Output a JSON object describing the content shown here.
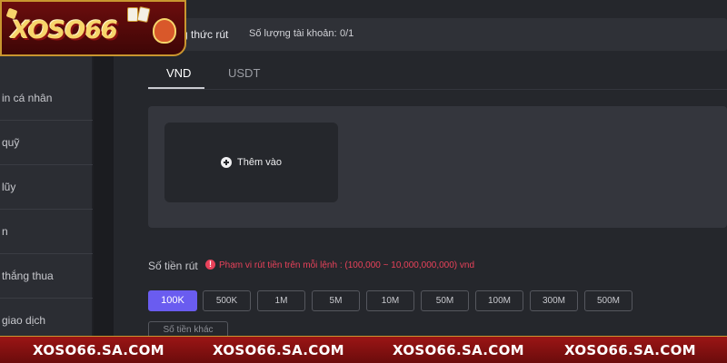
{
  "logo": {
    "text": "XOSO66"
  },
  "header": {
    "title": "g thức rút",
    "account_count_label": "Số lượng tài khoản:",
    "account_count_value": "0/1"
  },
  "sidebar": {
    "items": [
      {
        "label": "in cá nhân"
      },
      {
        "label": "quỹ"
      },
      {
        "label": "lũy"
      },
      {
        "label": "n"
      },
      {
        "label": "thắng thua"
      },
      {
        "label": "giao dịch"
      }
    ]
  },
  "tabs": [
    {
      "label": "VND",
      "active": true
    },
    {
      "label": "USDT",
      "active": false
    }
  ],
  "add_card": {
    "label": "Thêm vào",
    "icon": "plus-circle-icon"
  },
  "amount": {
    "label": "Số tiền rút",
    "range_note": "Phạm vi rút tiền trên mỗi lệnh : (100,000 ~ 10,000,000,000) vnd",
    "options": [
      "100K",
      "500K",
      "1M",
      "5M",
      "10M",
      "50M",
      "100M",
      "300M",
      "500M"
    ],
    "selected": "100K",
    "other_label": "Số tiền khác"
  },
  "banner": {
    "items": [
      "XOSO66.SA.COM",
      "XOSO66.SA.COM",
      "XOSO66.SA.COM",
      "XOSO66.SA.COM"
    ]
  },
  "colors": {
    "accent": "#6a5cf0",
    "warning": "#e8425a",
    "banner": "#9b1515",
    "logo_gold": "#f7d56a"
  }
}
